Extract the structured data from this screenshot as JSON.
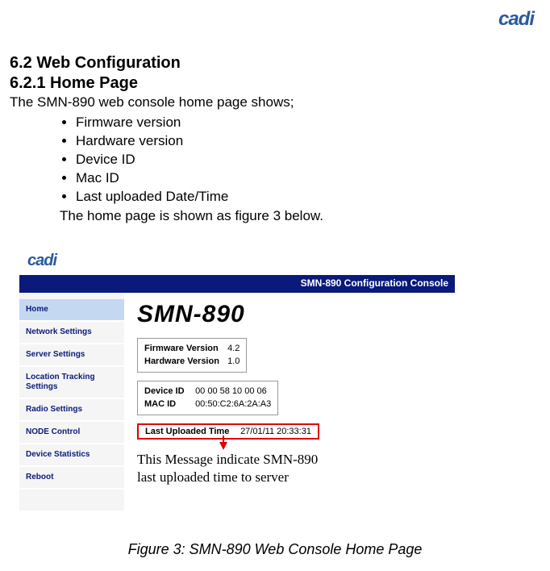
{
  "topLogo": "cadi",
  "heading1": "6.2 Web Configuration",
  "heading2": "6.2.1 Home Page",
  "introText": "The SMN-890 web console home page shows;",
  "bullets": {
    "0": "Firmware version",
    "1": "Hardware version",
    "2": "Device ID",
    "3": "Mac ID",
    "4": "Last uploaded Date/Time"
  },
  "afterList": "The home page is shown as figure 3 below.",
  "figure": {
    "logo": "cadi",
    "banner": "SMN-890 Configuration Console",
    "sidebar": {
      "0": "Home",
      "1": "Network Settings",
      "2": "Server Settings",
      "3": "Location Tracking Settings",
      "4": "Radio Settings",
      "5": "NODE Control",
      "6": "Device Statistics",
      "7": "Reboot"
    },
    "title": "SMN-890",
    "firmwareLabel": "Firmware Version",
    "firmwareValue": "4.2",
    "hardwareLabel": "Hardware Version",
    "hardwareValue": "1.0",
    "deviceIdLabel": "Device ID",
    "deviceIdValue": "00 00 58 10 00 06",
    "macIdLabel": "MAC ID",
    "macIdValue": "00:50:C2:6A:2A:A3",
    "lastUploadLabel": "Last Uploaded Time",
    "lastUploadValue": "27/01/11 20:33:31",
    "annotationLine1": "This Message indicate SMN-890",
    "annotationLine2": "last uploaded time to server"
  },
  "caption": "Figure 3: SMN-890 Web Console Home Page"
}
